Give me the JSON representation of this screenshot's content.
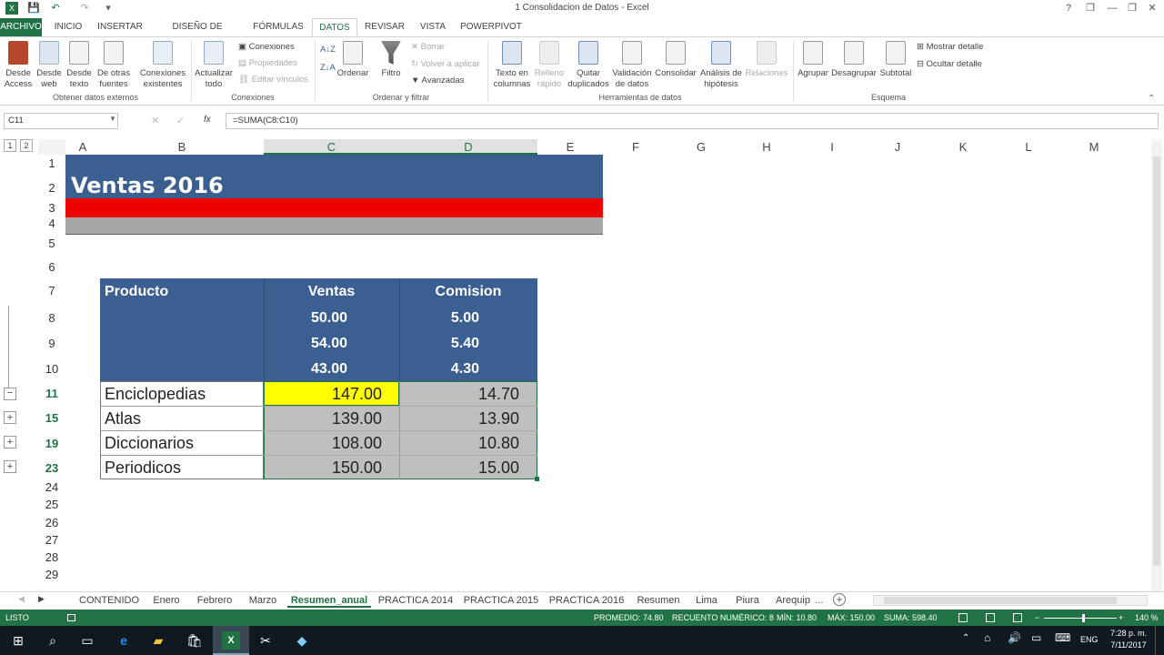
{
  "window": {
    "title": "1 Consolidacion de Datos - Excel",
    "help": "?",
    "minimize": "—",
    "restore": "❐",
    "close": "✕"
  },
  "quick_access": {
    "save": "💾",
    "undo": "↶",
    "redo": "↷",
    "customize": "▾"
  },
  "tabs": [
    "ARCHIVO",
    "INICIO",
    "INSERTAR",
    "DISEÑO DE PÁGINA",
    "FÓRMULAS",
    "DATOS",
    "REVISAR",
    "VISTA",
    "POWERPIVOT"
  ],
  "ribbon": {
    "external": {
      "access": "Desde Access",
      "web": "Desde web",
      "text": "Desde texto",
      "other": "De otras fuentes",
      "existing": "Conexiones existentes",
      "label": "Obtener datos externos"
    },
    "connections": {
      "refresh": "Actualizar todo",
      "connections": "Conexiones",
      "properties": "Propiedades",
      "edit_links": "Editar vínculos",
      "label": "Conexiones"
    },
    "sort": {
      "sort": "Ordenar",
      "filter": "Filtro",
      "clear": "Borrar",
      "reapply": "Volver a aplicar",
      "advanced": "Avanzadas",
      "label": "Ordenar y filtrar"
    },
    "tools": {
      "text_to_columns": "Texto en columnas",
      "flash_fill": "Relleno rápido",
      "remove_dup": "Quitar duplicados",
      "validation": "Validación de datos",
      "consolidate": "Consolidar",
      "what_if": "Análisis de hipótesis",
      "relations": "Relaciones",
      "label": "Herramientas de datos"
    },
    "outline": {
      "group": "Agrupar",
      "ungroup": "Desagrupar",
      "subtotal": "Subtotal",
      "show_detail": "Mostrar detalle",
      "hide_detail": "Ocultar detalle",
      "label": "Esquema"
    }
  },
  "formula_bar": {
    "name_box": "C11",
    "formula": "=SUMA(C8:C10)",
    "fx": "fx",
    "cancel": "✕",
    "enter": "✓"
  },
  "outline_levels": [
    "1",
    "2"
  ],
  "columns": [
    "A",
    "B",
    "C",
    "D",
    "E",
    "F",
    "G",
    "H",
    "I",
    "J",
    "K",
    "L",
    "M"
  ],
  "rows": [
    "1",
    "2",
    "3",
    "4",
    "5",
    "6",
    "7",
    "8",
    "9",
    "10",
    "11",
    "15",
    "19",
    "23",
    "24",
    "25",
    "26",
    "27",
    "28",
    "29"
  ],
  "sheet": {
    "title": "Ventas 2016",
    "headers": {
      "product": "Producto",
      "sales": "Ventas",
      "commission": "Comision"
    },
    "detail_rows": [
      {
        "sales": "50.00",
        "commission": "5.00"
      },
      {
        "sales": "54.00",
        "commission": "5.40"
      },
      {
        "sales": "43.00",
        "commission": "4.30"
      }
    ],
    "summary_rows": [
      {
        "product": "Enciclopedias",
        "sales": "147.00",
        "commission": "14.70"
      },
      {
        "product": "Atlas",
        "sales": "139.00",
        "commission": "13.90"
      },
      {
        "product": "Diccionarios",
        "sales": "108.00",
        "commission": "10.80"
      },
      {
        "product": "Periodicos",
        "sales": "150.00",
        "commission": "15.00"
      }
    ]
  },
  "sheet_tabs": [
    "CONTENIDO",
    "Enero",
    "Febrero",
    "Marzo",
    "Resumen_anual",
    "PRACTICA 2014",
    "PRACTICA 2015",
    "PRACTICA 2016",
    "Resumen",
    "Lima",
    "Piura",
    "Arequip"
  ],
  "sheet_tabs_more": "...",
  "status": {
    "mode": "LISTO",
    "average": "PROMEDIO: 74.80",
    "count": "RECUENTO NUMÉRICO: 8",
    "min": "MÍN: 10.80",
    "max": "MÁX: 150.00",
    "sum": "SUMA: 598.40",
    "zoom": "140 %"
  },
  "taskbar": {
    "lang": "ENG",
    "time": "7:28 p. m.",
    "date": "7/11/2017"
  },
  "colors": {
    "excel_green": "#217346",
    "header_blue": "#3b5f91",
    "red_band": "#ee0000",
    "gray_band": "#a6a6a6",
    "highlight": "#ffff00",
    "gray_cell": "#bfbfbf"
  }
}
